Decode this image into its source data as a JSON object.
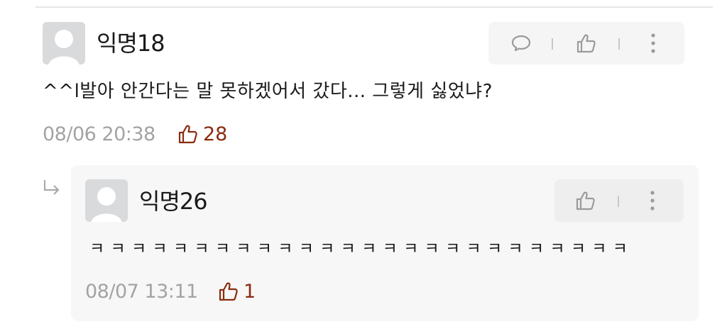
{
  "comment": {
    "author": "익명18",
    "body": "^^l발아 안간다는 말 못하겠어서 갔다...  그렇게 싫었냐?",
    "timestamp": "08/06 20:38",
    "likes": "28",
    "actions": [
      "comment-icon",
      "thumbs-up-icon",
      "more-vertical-icon"
    ]
  },
  "reply": {
    "author": "익명26",
    "body": "ㅋ ㅋ ㅋ ㅋ ㅋ ㅋ ㅋ ㅋ ㅋ ㅋ ㅋ ㅋ ㅋ ㅋ ㅋ ㅋ ㅋ ㅋ ㅋ ㅋ ㅋ ㅋ ㅋ ㅋ ㅋ ㅋ",
    "timestamp": "08/07 13:11",
    "likes": "1",
    "actions": [
      "thumbs-up-icon",
      "more-vertical-icon"
    ]
  },
  "colors": {
    "like_accent": "#8a2b10",
    "meta_gray": "#a3a3a3",
    "avatar_bg": "#d9dadb"
  }
}
